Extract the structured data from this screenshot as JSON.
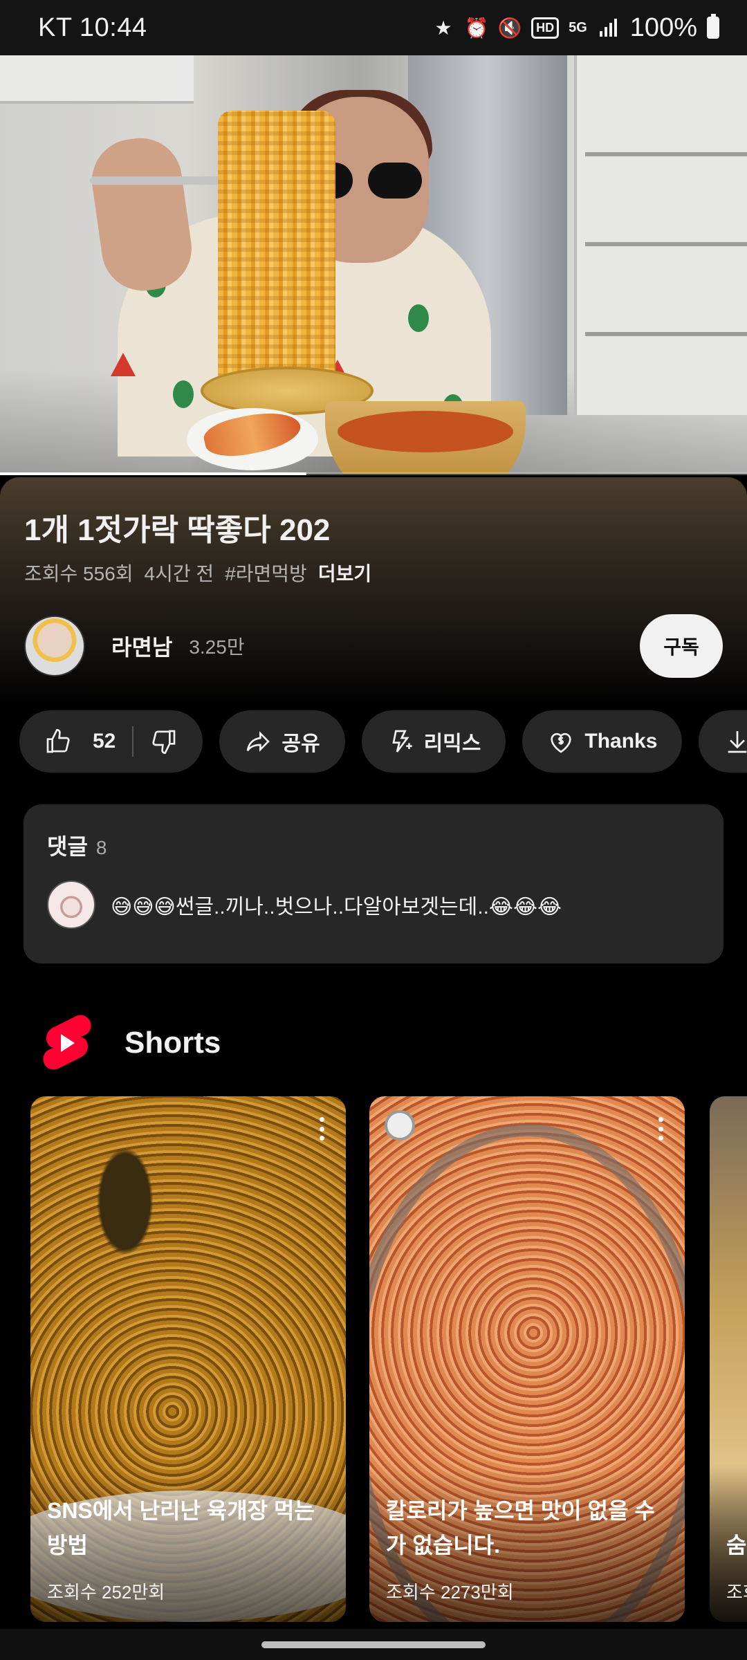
{
  "status_bar": {
    "carrier_time": "KT 10:44",
    "icons": [
      "star-icon",
      "alarm-icon",
      "mute-icon",
      "hd-icon",
      "5g-icon",
      "signal-icon"
    ],
    "hd": "HD",
    "network": "5G",
    "battery": "100%"
  },
  "video": {
    "progress_fraction": 0.41
  },
  "info": {
    "title": "1개 1젓가락 딱좋다 202",
    "views": "조회수 556회",
    "time_ago": "4시간 전",
    "hashtag": "#라면먹방",
    "more": "더보기",
    "channel_name": "라면남",
    "subscribers": "3.25만",
    "subscribe": "구독"
  },
  "actions": {
    "like_count": "52",
    "share": "공유",
    "remix": "리믹스",
    "thanks": "Thanks"
  },
  "comments": {
    "label": "댓글",
    "count": "8",
    "top_comment": "😅😅😅썬글..끼나..벗으나..다알아보겟는데..😂😂😂"
  },
  "shorts": {
    "label": "Shorts",
    "items": [
      {
        "title": "SNS에서 난리난 육개장 먹는 방법",
        "views": "조회수 252만회"
      },
      {
        "title": "칼로리가 높으면 맛이 없을 수가 없습니다.",
        "views": "조회수 2273만회"
      },
      {
        "title": "숨 이",
        "views": "조회"
      }
    ]
  },
  "colors": {
    "background": "#000000",
    "chip": "#272727",
    "shorts_red": "#ff0033",
    "subscribe_bg": "#f1f1f1"
  }
}
